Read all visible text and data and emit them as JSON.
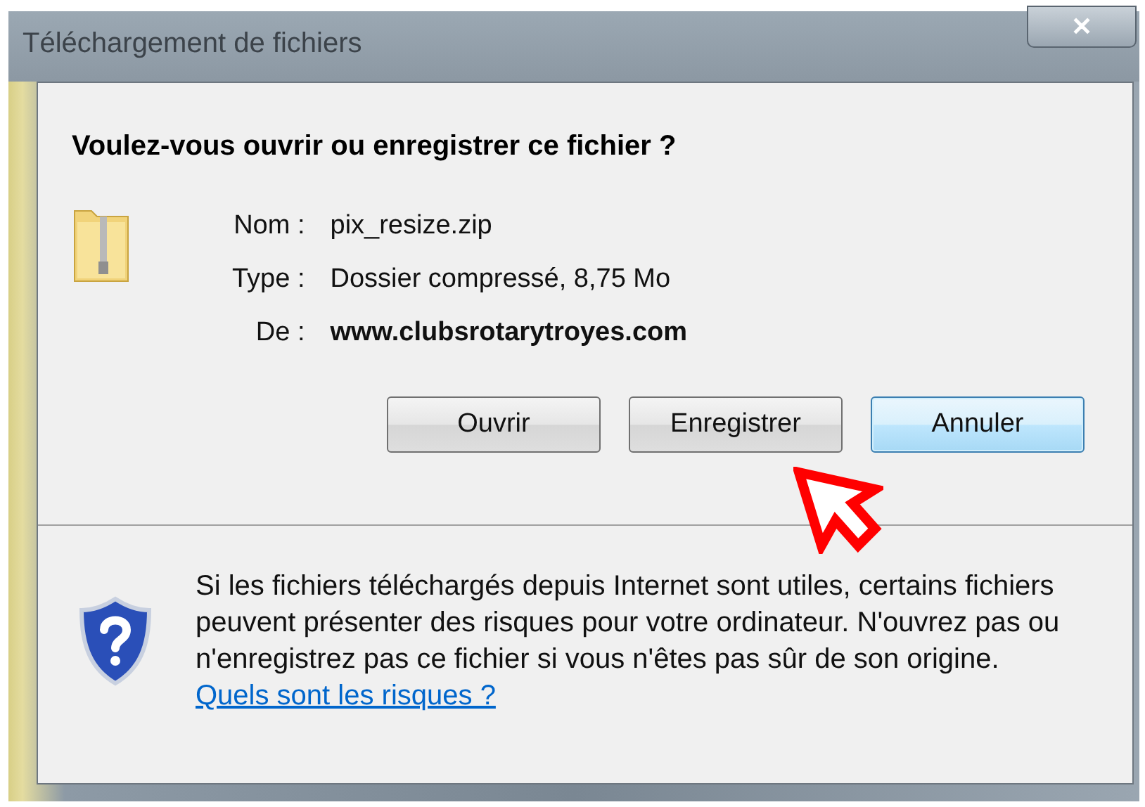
{
  "window": {
    "title": "Téléchargement de fichiers",
    "close_label": "✕"
  },
  "question": "Voulez-vous ouvrir ou enregistrer ce fichier ?",
  "details": [
    {
      "label": "Nom :",
      "value": "pix_resize.zip",
      "bold": false
    },
    {
      "label": "Type :",
      "value": "Dossier compressé, 8,75 Mo",
      "bold": false
    },
    {
      "label": "De :",
      "value": "www.clubsrotarytroyes.com",
      "bold": true
    }
  ],
  "buttons": [
    {
      "label": "Ouvrir",
      "focused": false
    },
    {
      "label": "Enregistrer",
      "focused": false
    },
    {
      "label": "Annuler",
      "focused": true
    }
  ],
  "warning": {
    "text": "Si les fichiers téléchargés depuis Internet sont utiles, certains fichiers peuvent présenter des risques pour votre ordinateur. N'ouvrez pas ou n'enregistrez pas ce fichier si vous n'êtes pas sûr de son origine.",
    "link": "Quels sont les risques ?"
  }
}
